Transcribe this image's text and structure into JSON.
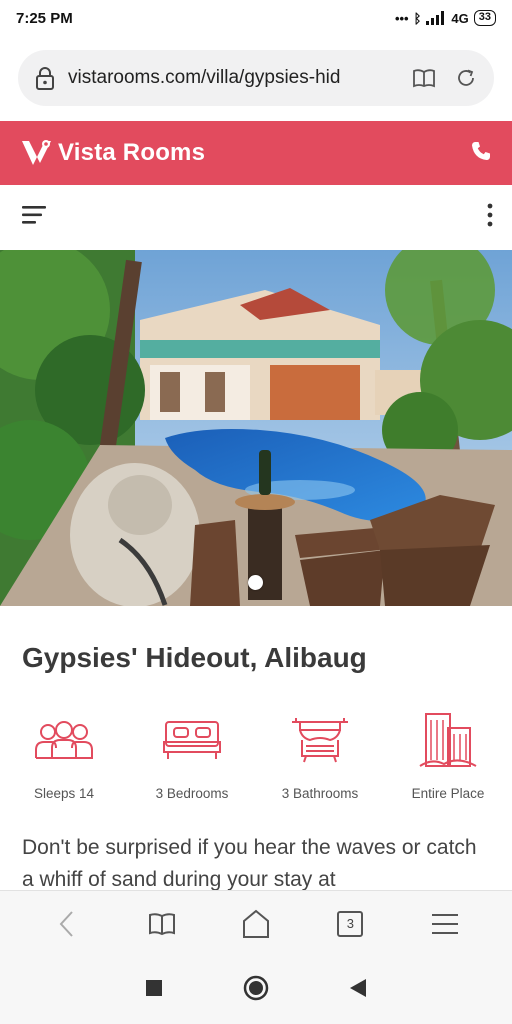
{
  "status": {
    "time": "7:25 PM",
    "network": "4G",
    "battery": "33"
  },
  "browser": {
    "url": "vistarooms.com/villa/gypsies-hid",
    "tab_count": "3"
  },
  "brand": {
    "name": "Vista Rooms",
    "color": "#e24b5e"
  },
  "listing": {
    "title": "Gypsies' Hideout, Alibaug",
    "amenities": [
      {
        "icon": "people-icon",
        "label": "Sleeps 14"
      },
      {
        "icon": "bed-icon",
        "label": "3 Bedrooms"
      },
      {
        "icon": "bathtub-icon",
        "label": "3 Bathrooms"
      },
      {
        "icon": "building-icon",
        "label": "Entire Place"
      }
    ],
    "description": "Don't be surprised if you hear the waves or catch a whiff of sand during your stay at"
  }
}
